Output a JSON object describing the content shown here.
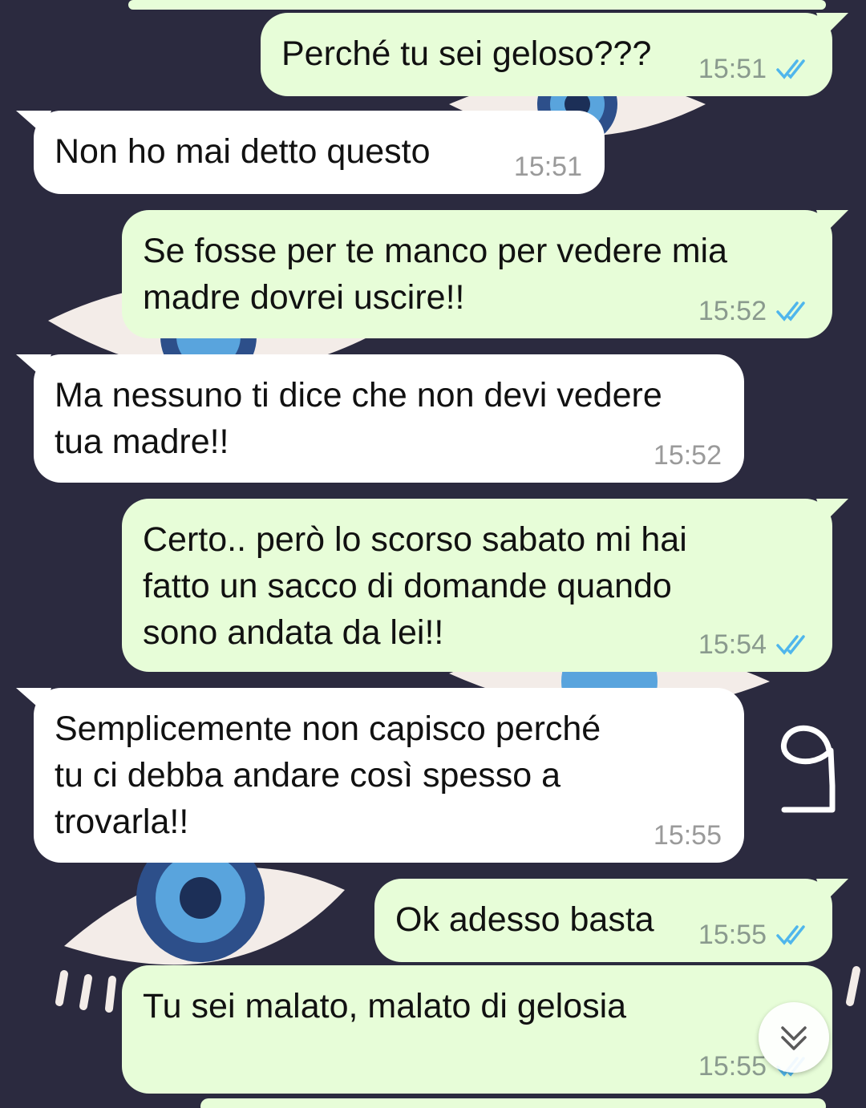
{
  "chat": {
    "messages": [
      {
        "direction": "out",
        "text_lines": [
          "Perché tu sei geloso???"
        ],
        "time": "15:51",
        "status": "read"
      },
      {
        "direction": "in",
        "text_lines": [
          "Non ho mai detto questo"
        ],
        "time": "15:51"
      },
      {
        "direction": "out",
        "text_lines": [
          "Se fosse per te manco per vedere mia",
          "madre dovrei uscire!!"
        ],
        "time": "15:52",
        "status": "read"
      },
      {
        "direction": "in",
        "text_lines": [
          "Ma nessuno ti dice che non devi vedere",
          "tua madre!!"
        ],
        "time": "15:52"
      },
      {
        "direction": "out",
        "text_lines": [
          "Certo.. però lo scorso sabato mi hai",
          "fatto un sacco di domande quando",
          "sono andata da lei!!"
        ],
        "time": "15:54",
        "status": "read"
      },
      {
        "direction": "in",
        "text_lines": [
          "Semplicemente non capisco perché",
          "tu ci debba andare così spesso a",
          "trovarla!!"
        ],
        "time": "15:55"
      },
      {
        "direction": "out",
        "text_lines": [
          "Ok adesso basta"
        ],
        "time": "15:55",
        "status": "read"
      },
      {
        "direction": "out",
        "text_lines": [
          "Tu sei malato, malato di gelosia"
        ],
        "time": "15:55",
        "status": "read"
      }
    ]
  },
  "overlay": {
    "handwritten_number": "9"
  },
  "colors": {
    "background": "#2b2a3f",
    "outgoing_bubble": "#e7fdd8",
    "incoming_bubble": "#ffffff",
    "read_ticks": "#4fb6ec",
    "timestamp": "#8a9a8e"
  },
  "icons": {
    "read_status": "double-check-icon",
    "scroll_down": "double-chevron-down-icon"
  }
}
